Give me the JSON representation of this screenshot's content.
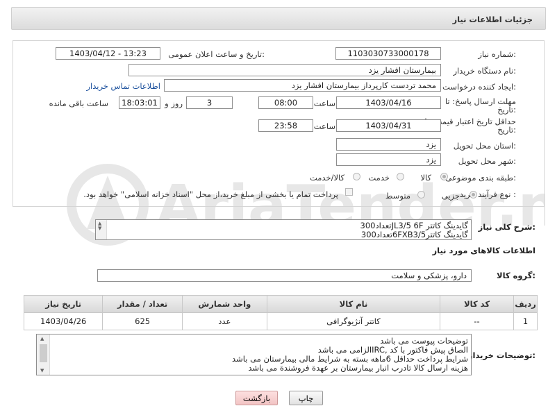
{
  "header": {
    "title": "جزئیات اطلاعات نیاز"
  },
  "form": {
    "need_number_label": "شماره نیاز:",
    "need_number": "1103030733000178",
    "announce_label": "تاریخ و ساعت اعلان عمومی:",
    "announce_value": "1403/04/12 - 13:23",
    "buyer_org_label": "نام دستگاه خریدار:",
    "buyer_org": "بیمارستان افشار یزد",
    "creator_label": "ایجاد کننده درخواست:",
    "creator": "محمد تردست کارپرداز بیمارستان افشار یزد",
    "contact_link": "اطلاعات تماس خریدار",
    "reply_deadline_label": "مهلت ارسال پاسخ: تا",
    "reply_deadline_label2": "تاریخ:",
    "reply_date": "1403/04/16",
    "time_label": "ساعت",
    "reply_time": "08:00",
    "days_value": "3",
    "days_label": "روز و",
    "remaining_time": "18:03:01",
    "remaining_label": "ساعت باقی مانده",
    "price_validity_label": "حداقل تاریخ اعتبار قیمت: تا",
    "price_validity_label2": "تاریخ:",
    "price_date": "1403/04/31",
    "price_time": "23:58",
    "province_label": "استان محل تحویل:",
    "province": "یزد",
    "city_label": "شهر محل تحویل:",
    "city": "یزد",
    "category_label": "طبقه بندی موضوعی:",
    "category_options": [
      "کالا",
      "خدمت",
      "کالا/خدمت"
    ],
    "process_label": "نوع فرآیند خرید :",
    "process_options": [
      "جزیی",
      "متوسط"
    ],
    "payment_note": "پرداخت تمام یا بخشی از مبلغ خرید،از محل \"اسناد خزانه اسلامی\" خواهد بود."
  },
  "description": {
    "label": "شرح کلی نیاز:",
    "lines": [
      "گایدینگ کاتتر  JL3/5   6Fتعداد300",
      "گایدینگ کاتتر6FXB3/5تعداد300"
    ]
  },
  "goods": {
    "section_title": "اطلاعات کالاهای مورد نیاز",
    "group_label": "گروه کالا:",
    "group_value": "دارو، پزشکی و سلامت",
    "columns": [
      "ردیف",
      "کد کالا",
      "نام کالا",
      "واحد شمارش",
      "تعداد / مقدار",
      "تاریخ نیاز"
    ],
    "rows": [
      {
        "row": "1",
        "code": "--",
        "name": "کاتتر آنژیوگرافی",
        "unit": "عدد",
        "qty": "625",
        "date": "1403/04/26"
      }
    ]
  },
  "buyer_notes": {
    "label": "توضیحات خریدار:",
    "lines": [
      "توضیحات پیوست می باشد",
      "الصاق پیش فاکتور با کد  ,IRCالزامی می باشد",
      "شرایط پرداخت   حداقل 6ماهه بسته به شرایط مالی بیمارستان می باشد",
      "هزینه ارسال کالا تادرب انبار بیمارستان بر عهدة فروشندة می باشد"
    ]
  },
  "buttons": {
    "print": "چاپ",
    "back": "بازگشت"
  },
  "watermark": {
    "text": "AriaTender.net"
  }
}
